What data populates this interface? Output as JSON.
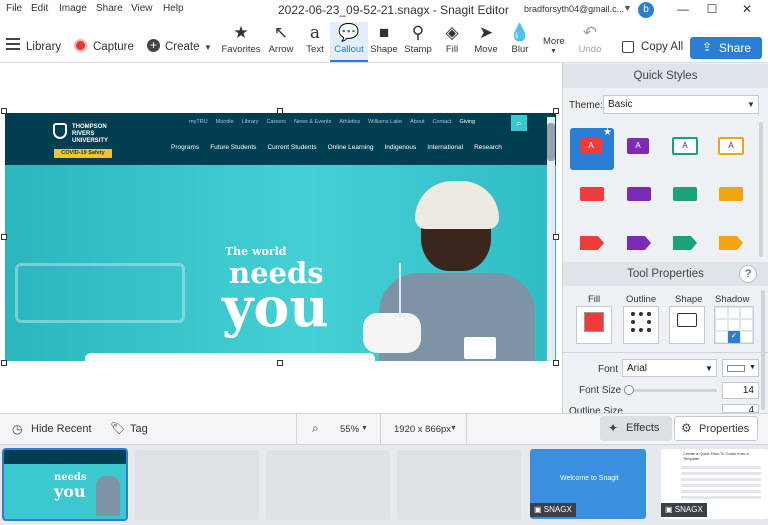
{
  "menu": [
    "File",
    "Edit",
    "Image",
    "Share",
    "View",
    "Help"
  ],
  "window": {
    "title": "2022-06-23_09-52-21.snagx - Snagit Editor",
    "account": "bradforsyth04@gmail.c...",
    "avatar": "b"
  },
  "toolbar": {
    "library": "Library",
    "capture": "Capture",
    "create": "Create",
    "tools": [
      {
        "label": "Favorites",
        "icon": "★"
      },
      {
        "label": "Arrow",
        "icon": "↖"
      },
      {
        "label": "Text",
        "icon": "a"
      },
      {
        "label": "Callout",
        "icon": "💬"
      },
      {
        "label": "Shape",
        "icon": "■"
      },
      {
        "label": "Stamp",
        "icon": "⚲"
      },
      {
        "label": "Fill",
        "icon": "◈"
      },
      {
        "label": "Move",
        "icon": "➤"
      },
      {
        "label": "Blur",
        "icon": "💧"
      }
    ],
    "more": "More",
    "undo": "Undo",
    "copy_all": "Copy All",
    "share": "Share"
  },
  "website": {
    "logo_lines": [
      "THOMPSON",
      "RIVERS",
      "UNIVERSITY"
    ],
    "covid": "COVID-19 Safety",
    "top_links": [
      "myTRU",
      "Moodle",
      "Library",
      "Careers",
      "News & Events",
      "Athletics",
      "Williams Lake",
      "About",
      "Contact",
      "Giving"
    ],
    "nav": [
      "Programs",
      "Future Students",
      "Current Students",
      "Online Learning",
      "Indigenous",
      "International",
      "Research"
    ],
    "hero_small": "The world",
    "hero_mid": "needs",
    "hero_big": "you"
  },
  "quick_styles": {
    "title": "Quick Styles",
    "theme_label": "Theme:",
    "theme_value": "Basic"
  },
  "tool_properties": {
    "title": "Tool Properties",
    "help": "?",
    "fill": "Fill",
    "outline": "Outline",
    "shape": "Shape",
    "shadow": "Shadow",
    "font_label": "Font",
    "font_value": "Arial",
    "font_size_label": "Font Size",
    "font_size_value": "14",
    "outline_size_label": "Outline Size",
    "outline_size_value": "4"
  },
  "bottom": {
    "hide_recent": "Hide Recent",
    "tag": "Tag",
    "zoom": "55%",
    "dimensions": "1920 x 866px",
    "effects": "Effects",
    "properties": "Properties"
  },
  "tray": {
    "thumb1": {
      "hero_mid": "needs",
      "hero_big": "you"
    },
    "snagx1": {
      "badge": "SNAGX",
      "welcome": "Welcome to Snagit"
    },
    "snagx2": {
      "badge": "SNAGX",
      "heading": "Create a Quick How-To Guide from a Template"
    }
  },
  "colors": {
    "accent": "#2a7fd4",
    "tru_navy": "#003e51",
    "tru_teal": "#3cc8cf",
    "covid_yellow": "#f2c530",
    "fill_red": "#ef3b3b"
  }
}
